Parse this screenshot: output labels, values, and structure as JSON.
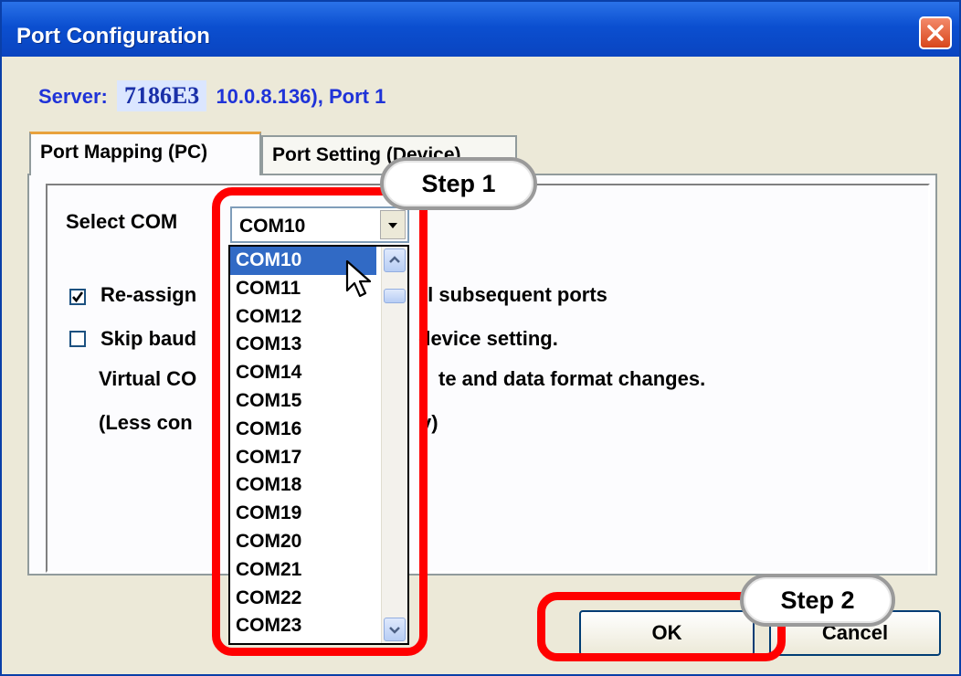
{
  "window": {
    "title": "Port Configuration"
  },
  "server": {
    "prefix": "Server:",
    "name": "7186E3",
    "suffix": "10.0.8.136), Port 1"
  },
  "tabs": [
    {
      "label": "Port Mapping (PC)"
    },
    {
      "label": "Port Setting (Device)"
    }
  ],
  "form": {
    "select_com_label": "Select COM",
    "combo_value": "COM10",
    "reassign_label_a": "Re-assign",
    "reassign_label_b": "ll subsequent ports",
    "reassign_checked": true,
    "skip_label_a": "Skip baud",
    "skip_label_b": "device setting.",
    "skip_checked": false,
    "virtual_line_a": "Virtual CO",
    "virtual_line_b": "te and data format changes.",
    "less_line_a": "(Less con",
    "less_line_b": "y)"
  },
  "dropdown": {
    "items": [
      "COM10",
      "COM11",
      "COM12",
      "COM13",
      "COM14",
      "COM15",
      "COM16",
      "COM17",
      "COM18",
      "COM19",
      "COM20",
      "COM21",
      "COM22",
      "COM23"
    ],
    "selected": "COM10"
  },
  "buttons": {
    "ok": "OK",
    "cancel": "Cancel"
  },
  "annotations": {
    "step1": "Step 1",
    "step2": "Step 2"
  },
  "colors": {
    "titlebar": "#0b4fd0",
    "highlight": "#ff0000",
    "selection": "#316ac5",
    "server_text": "#1f33d8"
  }
}
